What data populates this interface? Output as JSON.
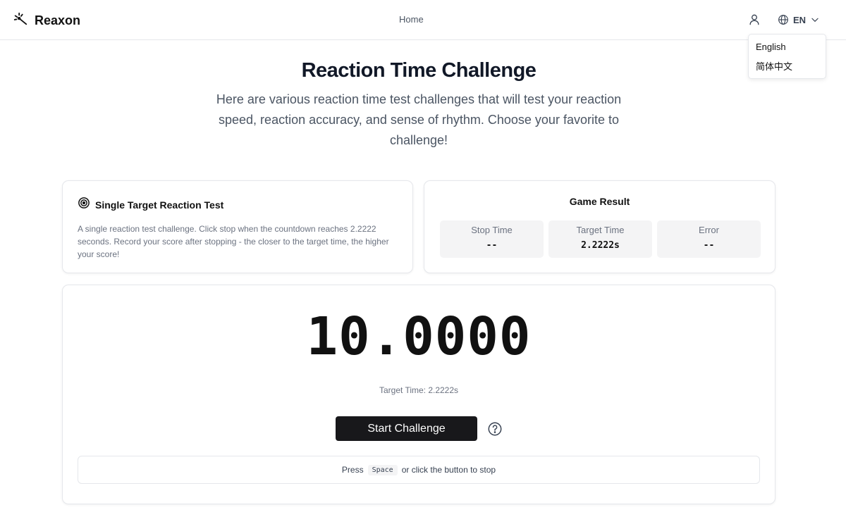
{
  "header": {
    "brand": "Reaxon",
    "nav_home": "Home",
    "language_code": "EN",
    "icons": {
      "logo": "reaxon-logo-icon",
      "user": "user-icon",
      "language": "globe-icon",
      "dropdown": "chevron-down-icon"
    }
  },
  "language_menu": {
    "items": [
      "English",
      "简体中文"
    ]
  },
  "hero": {
    "title": "Reaction Time Challenge",
    "subtitle": "Here are various reaction time test challenges that will test your reaction speed, reaction accuracy, and sense of rhythm. Choose your favorite to challenge!"
  },
  "info_card": {
    "title": "Single Target Reaction Test",
    "description": "A single reaction test challenge. Click stop when the countdown reaches 2.2222 seconds. Record your score after stopping - the closer to the target time, the higher your score!",
    "icon": "target-icon"
  },
  "result_card": {
    "title": "Game Result",
    "stats": [
      {
        "label": "Stop Time",
        "value": "--"
      },
      {
        "label": "Target Time",
        "value": "2.2222s"
      },
      {
        "label": "Error",
        "value": "--"
      }
    ]
  },
  "main": {
    "timer": "10.0000",
    "target_text": "Target Time: 2.2222s",
    "start_label": "Start Challenge",
    "help_icon": "help-circle-icon",
    "hint_prefix": "Press",
    "hint_key": "Space",
    "hint_suffix": "or click the button to stop"
  },
  "colors": {
    "primary_button": "#18181b",
    "stat_background": "#f4f4f5",
    "border": "#e5e7eb"
  }
}
